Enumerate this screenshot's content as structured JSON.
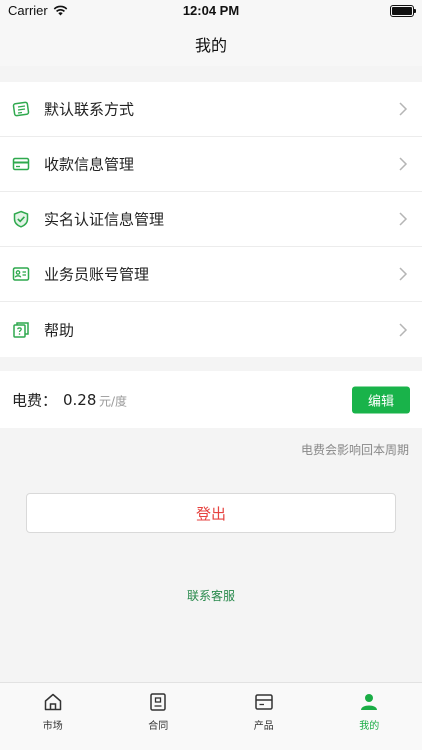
{
  "status": {
    "carrier": "Carrier",
    "time": "12:04 PM"
  },
  "nav": {
    "title": "我的"
  },
  "menu": {
    "items": [
      {
        "label": "默认联系方式",
        "icon": "contact-card-icon"
      },
      {
        "label": "收款信息管理",
        "icon": "bank-card-icon"
      },
      {
        "label": "实名认证信息管理",
        "icon": "shield-check-icon"
      },
      {
        "label": "业务员账号管理",
        "icon": "id-card-icon"
      },
      {
        "label": "帮助",
        "icon": "help-book-icon"
      }
    ]
  },
  "fee": {
    "label": "电费：",
    "value": "0.28",
    "unit": "元/度",
    "edit_label": "编辑",
    "note": "电费会影响回本周期"
  },
  "actions": {
    "logout_label": "登出",
    "contact_label": "联系客服"
  },
  "tabs": [
    {
      "label": "市场",
      "icon": "home-icon",
      "active": false
    },
    {
      "label": "合同",
      "icon": "contract-icon",
      "active": false
    },
    {
      "label": "产品",
      "icon": "product-icon",
      "active": false
    },
    {
      "label": "我的",
      "icon": "person-icon",
      "active": true
    }
  ],
  "colors": {
    "accent": "#19b34a",
    "danger": "#e64340",
    "link": "#27894b"
  }
}
